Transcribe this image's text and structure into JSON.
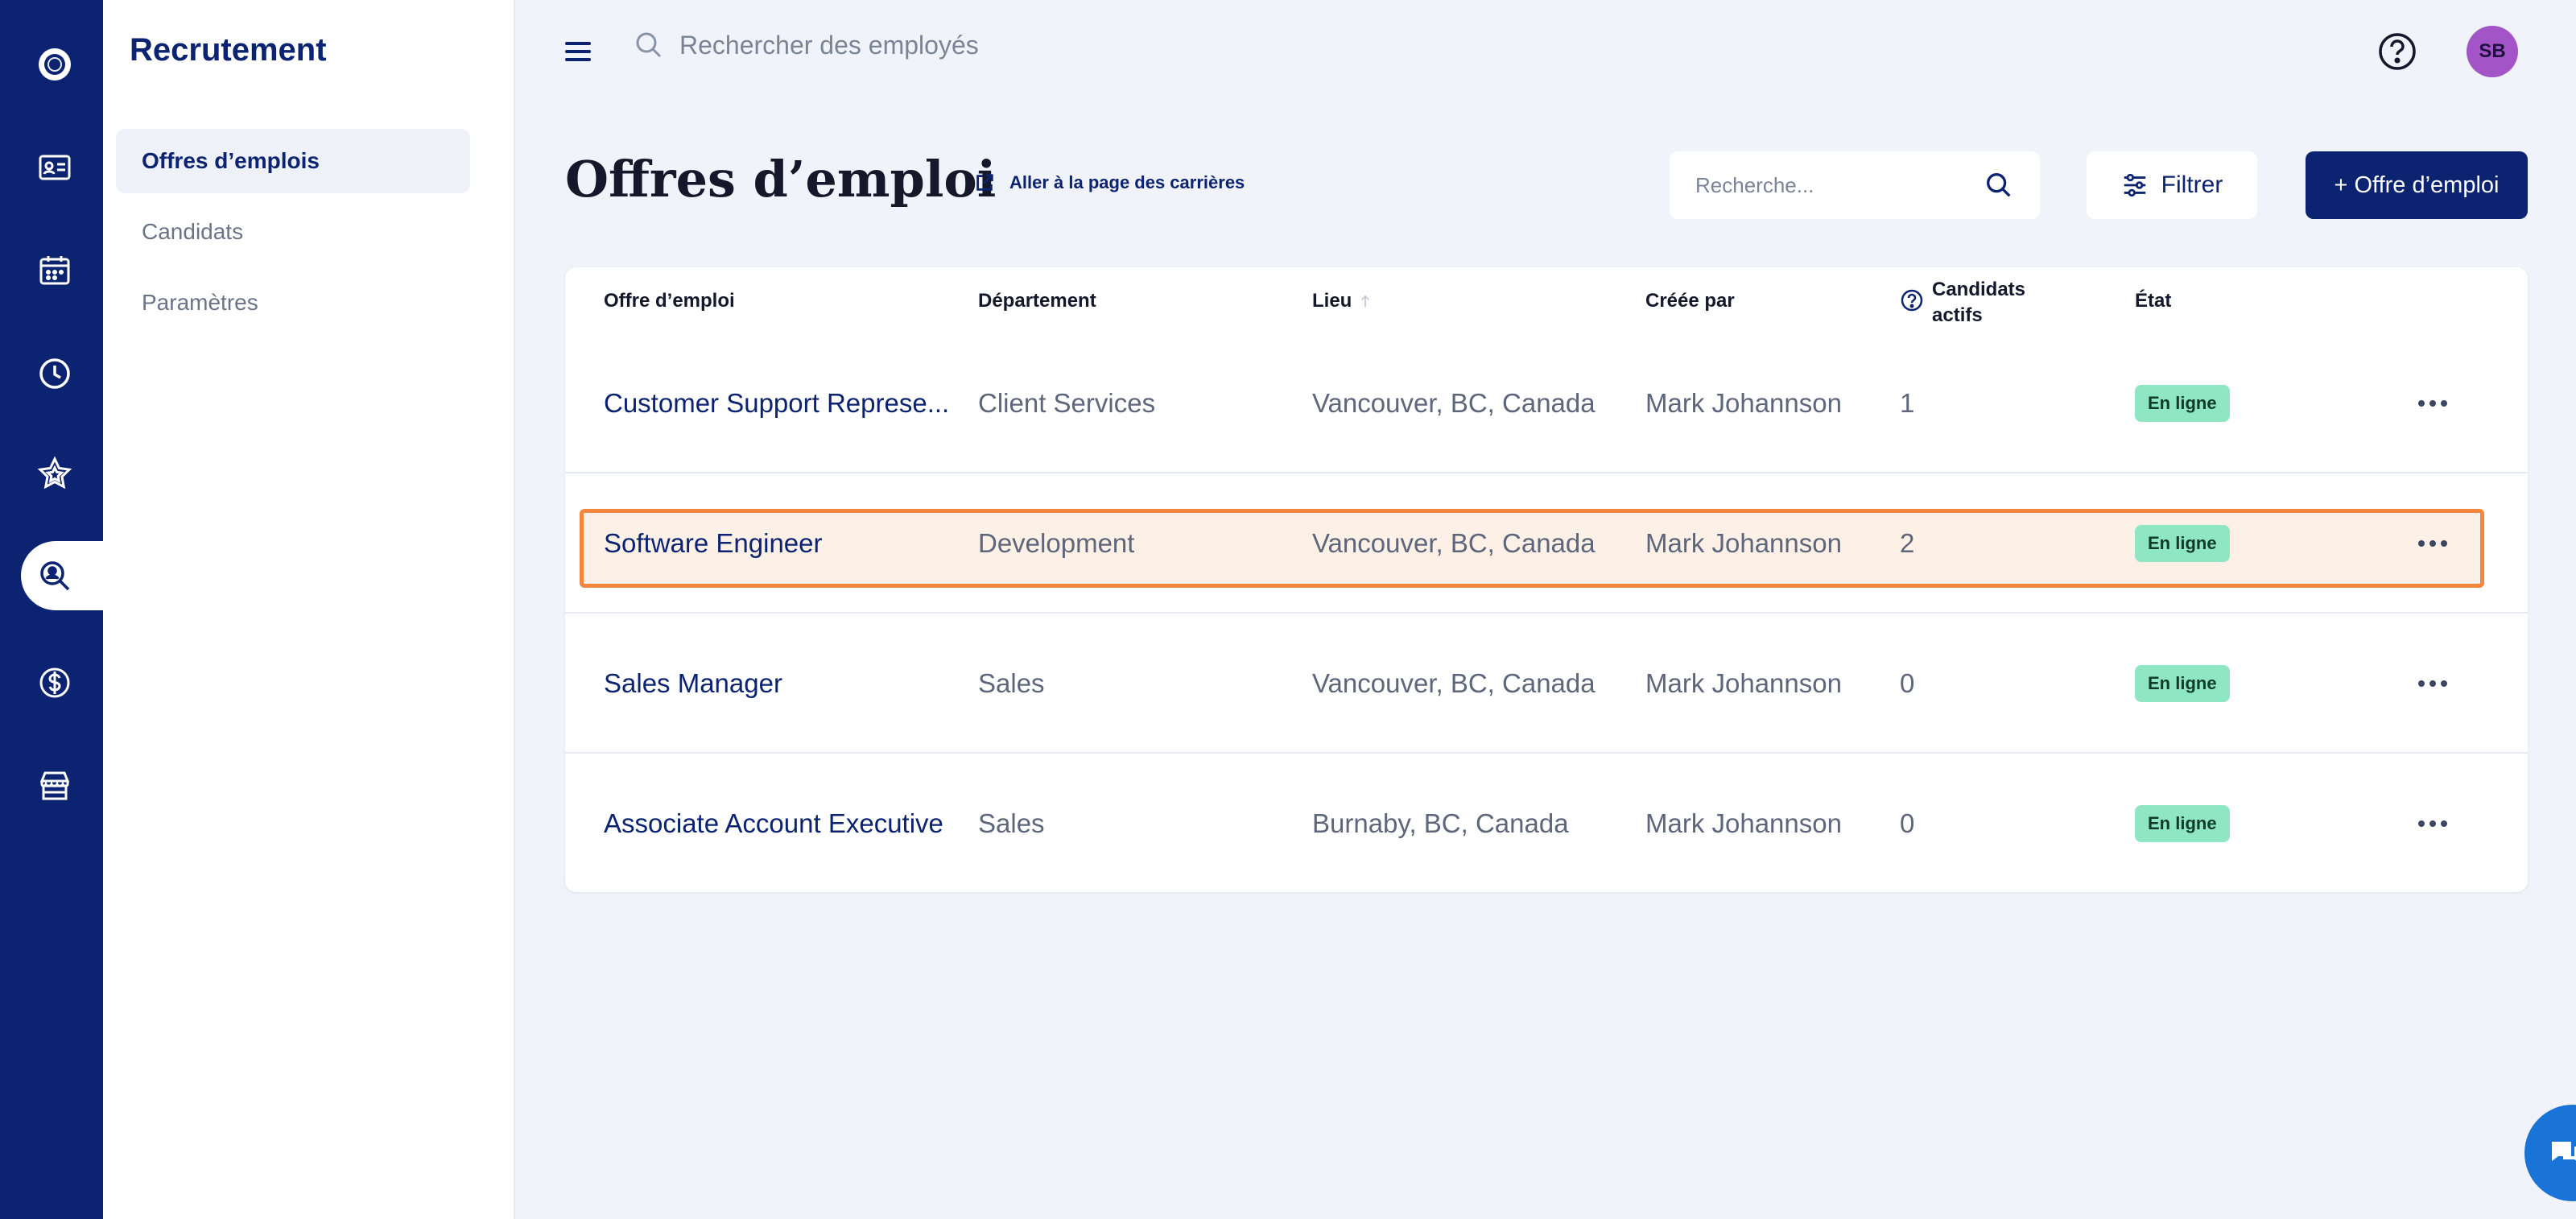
{
  "sidebar": {
    "title": "Recrutement",
    "items": [
      {
        "label": "Offres d’emplois",
        "active": true
      },
      {
        "label": "Candidats",
        "active": false
      },
      {
        "label": "Paramètres",
        "active": false
      }
    ]
  },
  "rail": {
    "icons": [
      "logo-icon",
      "employee-card-icon",
      "calendar-icon",
      "clock-icon",
      "star-icon",
      "recruit-search-icon",
      "dollar-icon",
      "store-icon"
    ],
    "active": "recruit-search-icon"
  },
  "topbar": {
    "search_placeholder": "Rechercher des employés",
    "avatar_initials": "SB"
  },
  "page": {
    "title": "Offres d’emploi",
    "careers_link": "Aller à la page des carrières",
    "search_placeholder": "Recherche...",
    "filter_label": "Filtrer",
    "add_label": "+ Offre d’emploi"
  },
  "table": {
    "columns": [
      "Offre d’emploi",
      "Département",
      "Lieu",
      "Créée par",
      "Candidats actifs",
      "État"
    ],
    "active_candidates_line1": "Candidats",
    "active_candidates_line2": "actifs",
    "rows": [
      {
        "title": "Customer Support Represe...",
        "department": "Client Services",
        "location": "Vancouver, BC, Canada",
        "created_by": "Mark Johannson",
        "active": "1",
        "status": "En ligne",
        "highlighted": false
      },
      {
        "title": "Software Engineer",
        "department": "Development",
        "location": "Vancouver, BC, Canada",
        "created_by": "Mark Johannson",
        "active": "2",
        "status": "En ligne",
        "highlighted": true
      },
      {
        "title": "Sales Manager",
        "department": "Sales",
        "location": "Vancouver, BC, Canada",
        "created_by": "Mark Johannson",
        "active": "0",
        "status": "En ligne",
        "highlighted": false
      },
      {
        "title": "Associate Account Executive",
        "department": "Sales",
        "location": "Burnaby, BC, Canada",
        "created_by": "Mark Johannson",
        "active": "0",
        "status": "En ligne",
        "highlighted": false
      }
    ]
  },
  "colors": {
    "navy": "#0b2370",
    "background": "#f0f3fa",
    "status_badge": "#8ee6c3",
    "highlight_border": "#f2873d",
    "avatar": "#a355c8"
  }
}
